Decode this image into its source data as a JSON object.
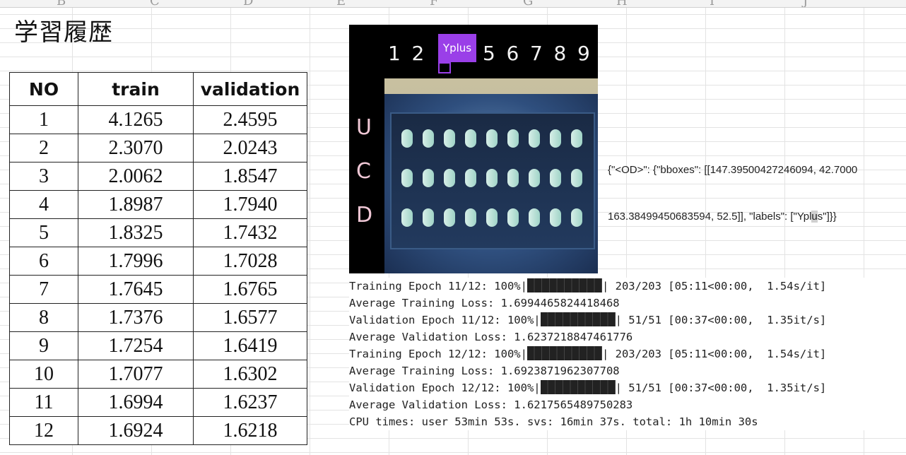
{
  "sheet": {
    "title": "学習履歴",
    "column_letters": [
      "B",
      "C",
      "D",
      "E",
      "F",
      "G",
      "H",
      "I",
      "J"
    ]
  },
  "history_table": {
    "headers": [
      "NO",
      "train",
      "validation"
    ],
    "rows": [
      [
        "1",
        "4.1265",
        "2.4595"
      ],
      [
        "2",
        "2.3070",
        "2.0243"
      ],
      [
        "3",
        "2.0062",
        "1.8547"
      ],
      [
        "4",
        "1.8987",
        "1.7940"
      ],
      [
        "5",
        "1.8325",
        "1.7432"
      ],
      [
        "6",
        "1.7996",
        "1.7028"
      ],
      [
        "7",
        "1.7645",
        "1.6765"
      ],
      [
        "8",
        "1.7376",
        "1.6577"
      ],
      [
        "9",
        "1.7254",
        "1.6419"
      ],
      [
        "10",
        "1.7077",
        "1.6302"
      ],
      [
        "11",
        "1.6994",
        "1.6237"
      ],
      [
        "12",
        "1.6924",
        "1.6218"
      ]
    ]
  },
  "detection_image": {
    "numbers": [
      "1",
      "2",
      "",
      "",
      "5",
      "6",
      "7",
      "8",
      "9"
    ],
    "row_letters": [
      "U",
      "C",
      "D"
    ],
    "bbox_label": "Yplus",
    "bbox_color": "#9a3fe8"
  },
  "od_output": {
    "line1": "{\"<OD>\": {\"bboxes\": [[147.39500427246094, 42.7000",
    "line2_pre": "163.38499450683594, 52.5]], \"labels\": [\"Ypl",
    "line2_hl": "u",
    "line2_post": "s\"]}}"
  },
  "log": {
    "lines": [
      {
        "pre": "Training Epoch 11/12: 100%|",
        "bar": true,
        "post": "| 203/203 [05:11<00:00,  1.54s/it]"
      },
      {
        "pre": "Average Training Loss: 1.6994465824418468",
        "bar": false,
        "post": ""
      },
      {
        "pre": "Validation Epoch 11/12: 100%|",
        "bar": true,
        "post": "| 51/51 [00:37<00:00,  1.35it/s]"
      },
      {
        "pre": "Average Validation Loss: 1.6237218847461776",
        "bar": false,
        "post": ""
      },
      {
        "pre": "Training Epoch 12/12: 100%|",
        "bar": true,
        "post": "| 203/203 [05:11<00:00,  1.54s/it]"
      },
      {
        "pre": "Average Training Loss: 1.6923871962307708",
        "bar": false,
        "post": ""
      },
      {
        "pre": "Validation Epoch 12/12: 100%|",
        "bar": true,
        "post": "| 51/51 [00:37<00:00,  1.35it/s]"
      },
      {
        "pre": "Average Validation Loss: 1.6217565489750283",
        "bar": false,
        "post": ""
      },
      {
        "pre": "CPU times: user 53min 53s. svs: 16min 37s. total: 1h 10min 30s",
        "bar": false,
        "post": ""
      }
    ],
    "progress_fraction": 1.0
  }
}
